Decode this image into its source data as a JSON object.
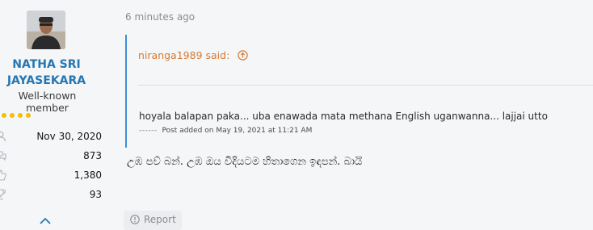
{
  "author": {
    "name_line1": "NATHA SRI",
    "name_line2": "JAYASEKARA",
    "title": "Well-known member",
    "stars_visible": 4,
    "stats": [
      {
        "icon": "user-icon",
        "value": "Nov 30, 2020"
      },
      {
        "icon": "messages-icon",
        "value": "873"
      },
      {
        "icon": "thumbs-up-icon",
        "value": "1,380"
      },
      {
        "icon": "trophy-icon",
        "value": "93"
      }
    ]
  },
  "post": {
    "time": "6 minutes ago",
    "quote": {
      "author_said": "niranga1989 said:",
      "text": "hoyala balapan paka... uba enawada mata methana English uganwanna... lajjai utto",
      "meta_dashes": "------",
      "meta": "Post added on May 19, 2021 at 11:21 AM"
    },
    "message": "උඹ පව් බන්. උඹ ඔය විදියටම හිතාගෙන ඉඳපන්. බායි",
    "report_label": "Report"
  },
  "colors": {
    "link_blue": "#2577b1",
    "quote_orange": "#d67a33",
    "quote_border": "#3d8fd6",
    "star_yellow": "#f2c000"
  }
}
